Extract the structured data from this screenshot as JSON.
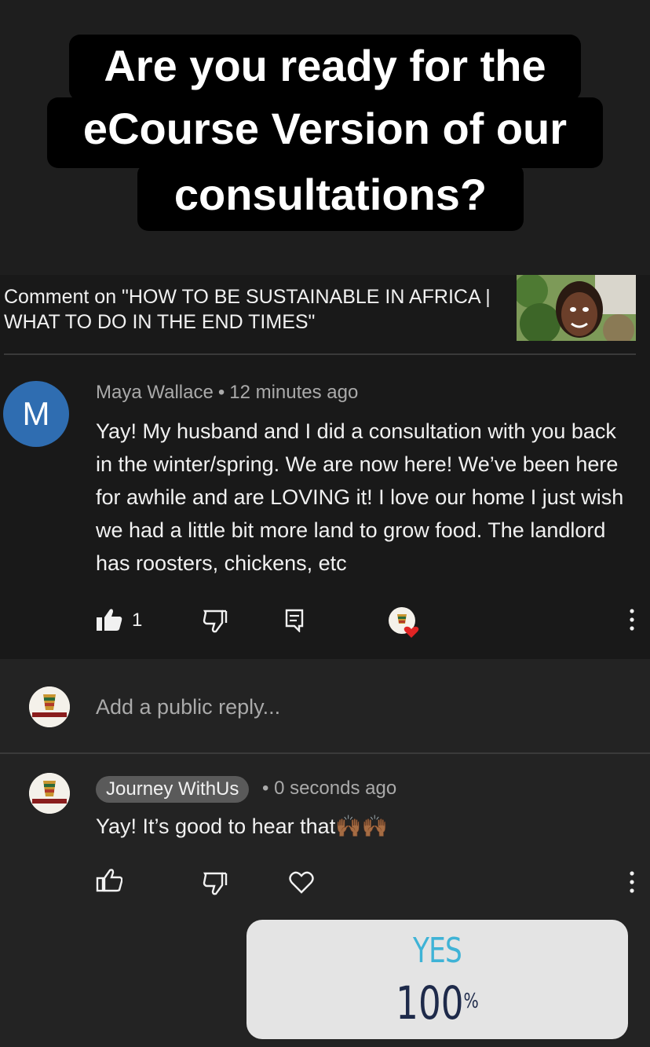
{
  "headline": {
    "line1": "Are you ready for the",
    "line2": "eCourse Version of our",
    "line3": "consultations?"
  },
  "video": {
    "comment_on": "Comment on \"HOW TO BE SUSTAINABLE IN AFRICA | WHAT TO DO IN THE END TIMES\""
  },
  "comment": {
    "avatar_letter": "M",
    "author": "Maya Wallace",
    "separator": "•",
    "time": "12 minutes ago",
    "text": "Yay! My husband and I did a consultation with you back in the winter/spring. We are now here! We’ve been here for awhile and are LOVING it! I love our home I just wish we had a little bit more land to grow food. The landlord has roosters, chickens, etc",
    "like_count": "1"
  },
  "reply_box": {
    "placeholder": "Add a public reply..."
  },
  "reply": {
    "author": "Journey WithUs",
    "time": "• 0 seconds ago",
    "text": "Yay! It’s good to hear that🙌🏾🙌🏾"
  },
  "poll": {
    "option": "YES",
    "percent": "100",
    "unit": "%",
    "option_color": "#3fb3d6"
  }
}
